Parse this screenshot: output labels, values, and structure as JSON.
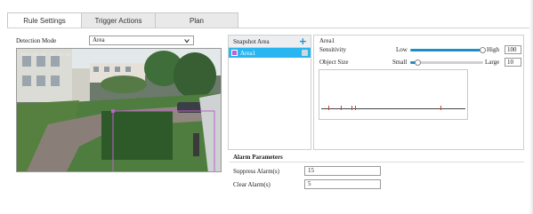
{
  "tabs": [
    {
      "label": "Rule Settings",
      "active": true
    },
    {
      "label": "Trigger Actions",
      "active": false
    },
    {
      "label": "Plan",
      "active": false
    }
  ],
  "detection_mode": {
    "label": "Detection Mode",
    "value": "Area"
  },
  "video": {
    "timestamp": "2018-03-06 10:22:18"
  },
  "snapshot_area": {
    "header": "Snapshot Area",
    "add_icon": "plus-icon",
    "items": [
      {
        "label": "Area1",
        "selected": true,
        "color": "#c060d0"
      }
    ]
  },
  "config": {
    "area_name": "Area1",
    "sensitivity": {
      "label": "Sensitivity",
      "min_label": "Low",
      "max_label": "High",
      "value": "100"
    },
    "object_size": {
      "label": "Object Size",
      "min_label": "Small",
      "max_label": "Large",
      "value": "10"
    }
  },
  "alarm": {
    "title": "Alarm Parameters",
    "suppress_label": "Suppress Alarm(s)",
    "suppress_value": "15",
    "clear_label": "Clear Alarm(s)",
    "clear_value": "5"
  },
  "colors": {
    "accent": "#1e8fc6",
    "selected_row": "#29b6f0",
    "region": "#c060d0",
    "alarm_tick": "#d23c3c"
  }
}
